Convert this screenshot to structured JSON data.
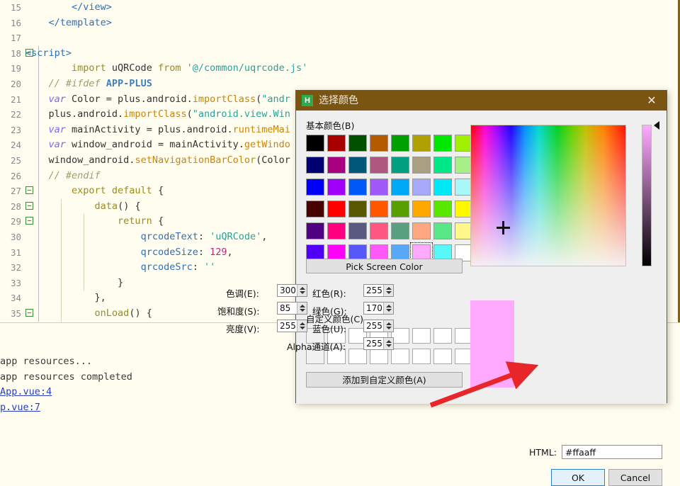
{
  "editor": {
    "first_line": 15,
    "lines": [
      {
        "n": 15,
        "fold": false,
        "indent": 0,
        "tokens": [
          {
            "t": "        ",
            "c": "tk-pl"
          },
          {
            "t": "</view>",
            "c": "tk-tag"
          }
        ]
      },
      {
        "n": 16,
        "fold": false,
        "indent": 0,
        "tokens": [
          {
            "t": "    ",
            "c": "tk-pl"
          },
          {
            "t": "</template>",
            "c": "tk-tag"
          }
        ]
      },
      {
        "n": 17,
        "fold": false,
        "indent": 0,
        "tokens": []
      },
      {
        "n": 18,
        "fold": true,
        "indent": 0,
        "tokens": [
          {
            "t": "<script>",
            "c": "tk-tag"
          }
        ]
      },
      {
        "n": 19,
        "fold": false,
        "indent": 0,
        "tokens": [
          {
            "t": "        import ",
            "c": "tk-kw2"
          },
          {
            "t": "uQRCode ",
            "c": "tk-ident"
          },
          {
            "t": "from ",
            "c": "tk-kw2"
          },
          {
            "t": "'@/common/uqrcode.js'",
            "c": "tk-str"
          }
        ]
      },
      {
        "n": 20,
        "fold": false,
        "indent": 0,
        "tokens": [
          {
            "t": "    // #ifdef ",
            "c": "tk-cmt"
          },
          {
            "t": "APP-PLUS",
            "c": "tk-cmt2"
          }
        ]
      },
      {
        "n": 21,
        "fold": false,
        "indent": 0,
        "tokens": [
          {
            "t": "    var ",
            "c": "tk-kw"
          },
          {
            "t": "Color = plus.android.",
            "c": "tk-ident"
          },
          {
            "t": "importClass",
            "c": "tk-fn"
          },
          {
            "t": "(",
            "c": "tk-ident"
          },
          {
            "t": "\"andr",
            "c": "tk-str"
          }
        ]
      },
      {
        "n": 22,
        "fold": false,
        "indent": 0,
        "tokens": [
          {
            "t": "    plus.android.",
            "c": "tk-ident"
          },
          {
            "t": "importClass",
            "c": "tk-fn"
          },
          {
            "t": "(",
            "c": "tk-ident"
          },
          {
            "t": "\"android.view.Win",
            "c": "tk-str"
          }
        ]
      },
      {
        "n": 23,
        "fold": false,
        "indent": 0,
        "tokens": [
          {
            "t": "    var ",
            "c": "tk-kw"
          },
          {
            "t": "mainActivity = plus.android.",
            "c": "tk-ident"
          },
          {
            "t": "runtimeMai",
            "c": "tk-fn"
          }
        ]
      },
      {
        "n": 24,
        "fold": false,
        "indent": 0,
        "tokens": [
          {
            "t": "    var ",
            "c": "tk-kw"
          },
          {
            "t": "window_android = mainActivity.",
            "c": "tk-ident"
          },
          {
            "t": "getWindo",
            "c": "tk-fn"
          }
        ]
      },
      {
        "n": 25,
        "fold": false,
        "indent": 0,
        "tokens": [
          {
            "t": "    window_android.",
            "c": "tk-ident"
          },
          {
            "t": "setNavigationBarColor",
            "c": "tk-fn"
          },
          {
            "t": "(Color",
            "c": "tk-ident"
          }
        ]
      },
      {
        "n": 26,
        "fold": false,
        "indent": 0,
        "tokens": [
          {
            "t": "    // #endif",
            "c": "tk-cmt"
          }
        ]
      },
      {
        "n": 27,
        "fold": true,
        "indent": 0,
        "tokens": [
          {
            "t": "        export default ",
            "c": "tk-kw2"
          },
          {
            "t": "{",
            "c": "tk-ident"
          }
        ]
      },
      {
        "n": 28,
        "fold": true,
        "indent": 1,
        "tokens": [
          {
            "t": "            ",
            "c": "tk-pl"
          },
          {
            "t": "data",
            "c": "tk-kw2"
          },
          {
            "t": "() {",
            "c": "tk-ident"
          }
        ]
      },
      {
        "n": 29,
        "fold": true,
        "indent": 2,
        "tokens": [
          {
            "t": "                ",
            "c": "tk-pl"
          },
          {
            "t": "return ",
            "c": "tk-kw2"
          },
          {
            "t": "{",
            "c": "tk-ident"
          }
        ]
      },
      {
        "n": 30,
        "fold": false,
        "indent": 2,
        "tokens": [
          {
            "t": "                    ",
            "c": "tk-pl"
          },
          {
            "t": "qrcodeText",
            "c": "tk-prop"
          },
          {
            "t": ": ",
            "c": "tk-ident"
          },
          {
            "t": "'uQRCode'",
            "c": "tk-str"
          },
          {
            "t": ",",
            "c": "tk-ident"
          }
        ]
      },
      {
        "n": 31,
        "fold": false,
        "indent": 2,
        "tokens": [
          {
            "t": "                    ",
            "c": "tk-pl"
          },
          {
            "t": "qrcodeSize",
            "c": "tk-prop"
          },
          {
            "t": ": ",
            "c": "tk-ident"
          },
          {
            "t": "129",
            "c": "tk-num"
          },
          {
            "t": ",",
            "c": "tk-ident"
          }
        ]
      },
      {
        "n": 32,
        "fold": false,
        "indent": 2,
        "tokens": [
          {
            "t": "                    ",
            "c": "tk-pl"
          },
          {
            "t": "qrcodeSrc",
            "c": "tk-prop"
          },
          {
            "t": ": ",
            "c": "tk-ident"
          },
          {
            "t": "''",
            "c": "tk-str"
          }
        ]
      },
      {
        "n": 33,
        "fold": false,
        "indent": 2,
        "tokens": [
          {
            "t": "                ",
            "c": "tk-pl"
          },
          {
            "t": "}",
            "c": "tk-ident"
          }
        ]
      },
      {
        "n": 34,
        "fold": false,
        "indent": 1,
        "tokens": [
          {
            "t": "            ",
            "c": "tk-pl"
          },
          {
            "t": "},",
            "c": "tk-ident"
          }
        ]
      },
      {
        "n": 35,
        "fold": true,
        "indent": 1,
        "tokens": [
          {
            "t": "            ",
            "c": "tk-pl"
          },
          {
            "t": "onLoad",
            "c": "tk-kw2"
          },
          {
            "t": "() {",
            "c": "tk-ident"
          }
        ]
      }
    ]
  },
  "console": {
    "lines": [
      {
        "text": "app resources...",
        "link": false
      },
      {
        "text": "app resources completed",
        "link": false
      },
      {
        "text": "App.vue:4",
        "link": true
      },
      {
        "text": "p.vue:7",
        "link": true
      }
    ]
  },
  "dialog": {
    "title": "选择颜色",
    "icon_label": "H",
    "close_label": "✕",
    "basic_colors_label": "基本颜色(B)",
    "custom_colors_label": "自定义颜色(C)",
    "pick_screen_color_label": "Pick Screen Color",
    "add_custom_label": "添加到自定义颜色(A)",
    "html_label": "HTML:",
    "html_value": "#ffaaff",
    "ok_label": "OK",
    "cancel_label": "Cancel",
    "preview_color": "#ffaaff",
    "selected_swatch_index": 45,
    "basic_colors": [
      "#000000",
      "#a80000",
      "#005000",
      "#b45a00",
      "#00a000",
      "#b0a000",
      "#00e800",
      "#a0f000",
      "#000070",
      "#a80080",
      "#005878",
      "#b05880",
      "#00a080",
      "#a8a080",
      "#00e888",
      "#a8f088",
      "#0000f8",
      "#a000f8",
      "#0058f8",
      "#a058f8",
      "#00a8f8",
      "#a8a8f8",
      "#00e8f8",
      "#a8f8f8",
      "#480000",
      "#ff0000",
      "#585800",
      "#ff5800",
      "#58a000",
      "#ffa800",
      "#58e800",
      "#fff800",
      "#500080",
      "#ff0080",
      "#585880",
      "#ff5880",
      "#58a080",
      "#ffa880",
      "#58e888",
      "#fff888",
      "#5000f8",
      "#ff00f8",
      "#5858f8",
      "#ff58f8",
      "#58a8f8",
      "#ffaaff",
      "#58f8f8",
      "#ffffff"
    ],
    "custom_colors_rows": 2,
    "custom_colors_cols": 8,
    "fields": [
      {
        "label": "色调(E):",
        "value": "300",
        "name": "hue"
      },
      {
        "label": "红色(R):",
        "value": "255",
        "name": "red"
      },
      {
        "label": "饱和度(S):",
        "value": "85",
        "name": "saturation"
      },
      {
        "label": "绿色(G):",
        "value": "170",
        "name": "green"
      },
      {
        "label": "亮度(V):",
        "value": "255",
        "name": "value"
      },
      {
        "label": "蓝色(U):",
        "value": "255",
        "name": "blue"
      },
      {
        "label": "Alpha通道(A):",
        "value": "255",
        "name": "alpha"
      }
    ],
    "accent_color": "#7a5512",
    "annotation_arrow_color": "#e8262a"
  }
}
